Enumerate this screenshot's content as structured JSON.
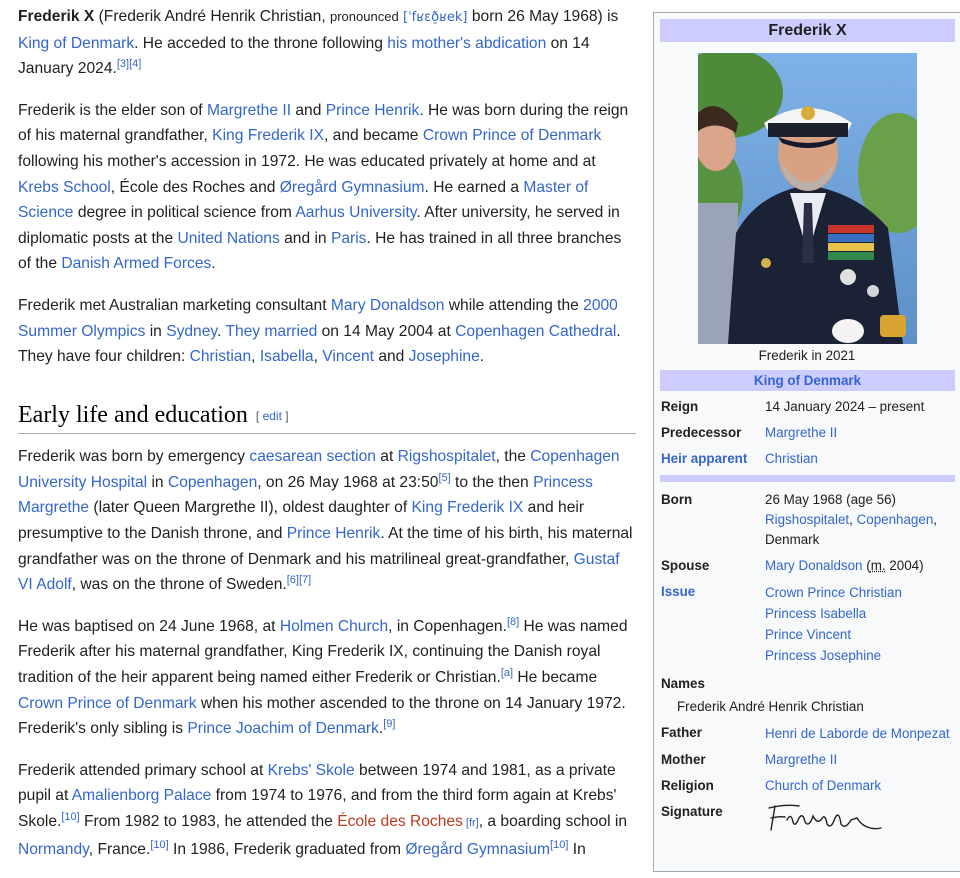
{
  "article": {
    "intro": {
      "subject_bold": "Frederik X",
      "t1": " (Frederik André Henrik Christian, ",
      "pronounced": "pronounced",
      "ipa": "[ˈfʁɛð̠ʁek]",
      "t2": " born 26 May 1968) is ",
      "link_king": "King of Denmark",
      "t3": ". He acceded to the throne following ",
      "link_abdication": "his mother's abdication",
      "t4": " on 14 January 2024.",
      "ref3": "[3]",
      "ref4": "[4]"
    },
    "p2": {
      "t1": "Frederik is the elder son of ",
      "l_margrethe": "Margrethe II",
      "t2": " and ",
      "l_henrik": "Prince Henrik",
      "t3": ". He was born during the reign of his maternal grandfather, ",
      "l_fred9": "King Frederik IX",
      "t4": ", and became ",
      "l_crownprince": "Crown Prince of Denmark",
      "t5": " following his mother's accession in 1972. He was educated privately at home and at ",
      "l_krebs": "Krebs School",
      "t6": ", École des Roches and ",
      "l_oregard": "Øregård Gymnasium",
      "t7": ". He earned a ",
      "l_master": "Master of Science",
      "t8": " degree in political science from ",
      "l_aarhus": "Aarhus University",
      "t9": ". After university, he served in diplomatic posts at the ",
      "l_un": "United Nations",
      "t10": " and in ",
      "l_paris": "Paris",
      "t11": ". He has trained in all three branches of the ",
      "l_armed": "Danish Armed Forces",
      "t12": "."
    },
    "p3": {
      "t1": "Frederik met Australian marketing consultant ",
      "l_mary": "Mary Donaldson",
      "t2": " while attending the ",
      "l_olympics": "2000 Summer Olympics",
      "t3": " in ",
      "l_sydney": "Sydney",
      "t4": ". ",
      "l_married": "They married",
      "t5": " on 14 May 2004 at ",
      "l_cathedral": "Copenhagen Cathedral",
      "t6": ". They have four children: ",
      "l_christian": "Christian",
      "t7": ", ",
      "l_isabella": "Isabella",
      "t8": ", ",
      "l_vincent": "Vincent",
      "t9": " and ",
      "l_josephine": "Josephine",
      "t10": "."
    },
    "section": {
      "heading": "Early life and education",
      "edit_open": "[ ",
      "edit": "edit",
      "edit_close": " ]"
    },
    "s1": {
      "t1": "Frederik was born by emergency ",
      "l_caesarean": "caesarean section",
      "t2": " at ",
      "l_rigs": "Rigshospitalet",
      "t3": ", the ",
      "l_cuh": "Copenhagen University Hospital",
      "t4": " in ",
      "l_copenhagen": "Copenhagen",
      "t5": ", on 26 May 1968 at 23:50",
      "ref5": "[5]",
      "t6": " to the then ",
      "l_princess": "Princess Margrethe",
      "t7": " (later Queen Margrethe II), oldest daughter of ",
      "l_fred9": "King Frederik IX",
      "t8": " and heir presumptive to the Danish throne, and ",
      "l_henrik": "Prince Henrik",
      "t9": ". At the time of his birth, his maternal grandfather was on the throne of Denmark and his matrilineal great-grandfather, ",
      "l_gustaf": "Gustaf VI Adolf",
      "t10": ", was on the throne of Sweden.",
      "ref6": "[6]",
      "ref7": "[7]"
    },
    "s2": {
      "t1": "He was baptised on 24 June 1968, at ",
      "l_holmen": "Holmen Church",
      "t2": ", in Copenhagen.",
      "ref8": "[8]",
      "t3": " He was named Frederik after his maternal grandfather, King Frederik IX, continuing the Danish royal tradition of the heir apparent being named either Frederik or Christian.",
      "refa": "[a]",
      "t4": " He became ",
      "l_crownprince": "Crown Prince of Denmark",
      "t5": " when his mother ascended to the throne on 14 January 1972. Frederik's only sibling is ",
      "l_joachim": "Prince Joachim of Denmark",
      "t6": ".",
      "ref9": "[9]"
    },
    "s3": {
      "t1": "Frederik attended primary school at ",
      "l_krebs": "Krebs' Skole",
      "t2": " between 1974 and 1981, as a private pupil at ",
      "l_amalienborg": "Amalienborg Palace",
      "t3": " from 1974 to 1976, and from the third form again at Krebs' Skole.",
      "ref10a": "[10]",
      "t4": " From 1982 to 1983, he attended the ",
      "l_ecole": "École des Roches",
      "fr": " [fr]",
      "t5": ", a boarding school in ",
      "l_normandy": "Normandy",
      "t6": ", France.",
      "ref10b": "[10]",
      "t7": " In 1986, Frederik graduated from ",
      "l_oregard": "Øregård Gymnasium",
      "ref10c": "[10]",
      "t8": " In"
    }
  },
  "infobox": {
    "title": "Frederik X",
    "caption": "Frederik in 2021",
    "subheader": "King of Denmark",
    "reign_label": "Reign",
    "reign_value": "14 January 2024 – present",
    "predecessor_label": "Predecessor",
    "predecessor_value": "Margrethe II",
    "heir_label": "Heir apparent",
    "heir_value": "Christian",
    "born_label": "Born",
    "born_date": "26 May 1968 (age 56)",
    "born_place1": "Rigshospitalet",
    "born_sep": ", ",
    "born_place2": "Copenhagen",
    "born_place3": ", Denmark",
    "spouse_label": "Spouse",
    "spouse_name": "Mary Donaldson",
    "spouse_open": " (",
    "spouse_m": "m.",
    "spouse_year": " 2004)",
    "issue_label": "Issue",
    "issue": [
      "Crown Prince Christian",
      "Princess Isabella",
      "Prince Vincent",
      "Princess Josephine"
    ],
    "names_label": "Names",
    "names_value": "Frederik André Henrik Christian",
    "father_label": "Father",
    "father_value": "Henri de Laborde de Monpezat",
    "mother_label": "Mother",
    "mother_value": "Margrethe II",
    "religion_label": "Religion",
    "religion_value": "Church of Denmark",
    "signature_label": "Signature"
  }
}
